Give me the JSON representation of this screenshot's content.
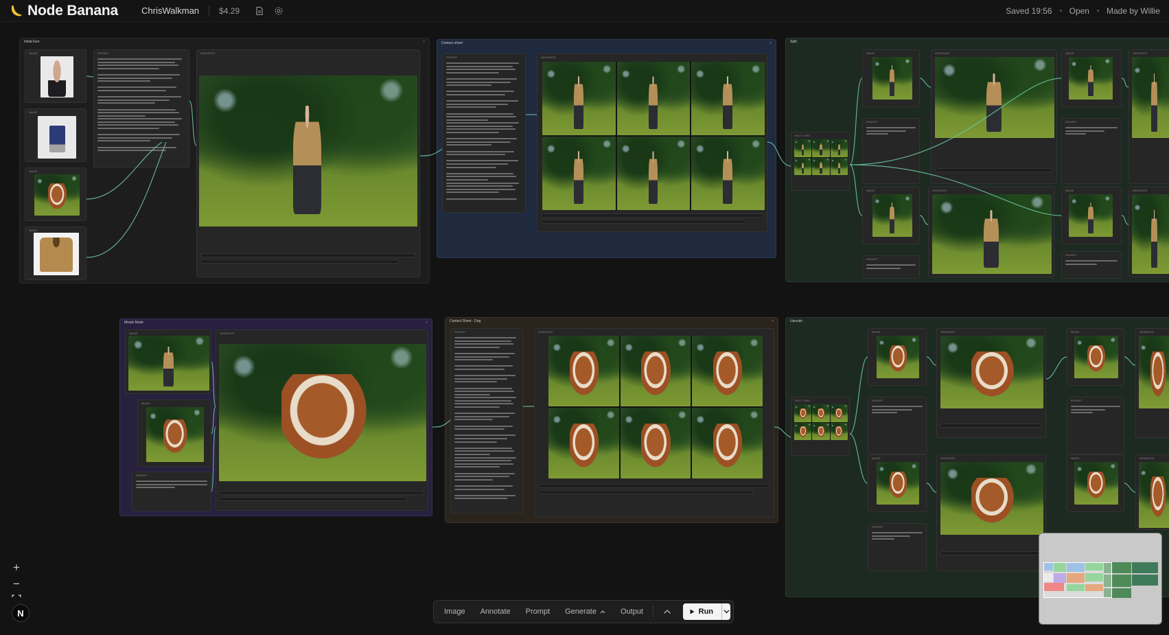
{
  "header": {
    "app_title": "Node Banana",
    "user": "ChrisWalkman",
    "cost": "$4.29",
    "saved": "Saved 19:56",
    "open": "Open",
    "made_by": "Made by Willie"
  },
  "groups": {
    "initial_gen": "Initial Gen",
    "contact_sheet": "Contact sheet",
    "split": "Split",
    "morph_mode": "Morph Mode",
    "contact_sheet_dog": "Contact Sheet - Dog",
    "upscale": "Upscale"
  },
  "node_labels": {
    "image": "IMAGE",
    "prompt": "PROMPT",
    "generate": "GENERATE",
    "split_grid": "SPLIT GRID"
  },
  "toolbar": {
    "image": "Image",
    "annotate": "Annotate",
    "prompt": "Prompt",
    "generate": "Generate",
    "output": "Output",
    "run": "Run"
  },
  "zoom": {
    "in": "+",
    "out": "−"
  },
  "badge": "N",
  "colors": {
    "group_blue": "#1f2a3f",
    "group_green": "#1d2a22",
    "group_purple": "#28203f",
    "group_brown": "#2a241d",
    "group_gray": "#1d1d1d",
    "wire": "#6fc7a6"
  }
}
